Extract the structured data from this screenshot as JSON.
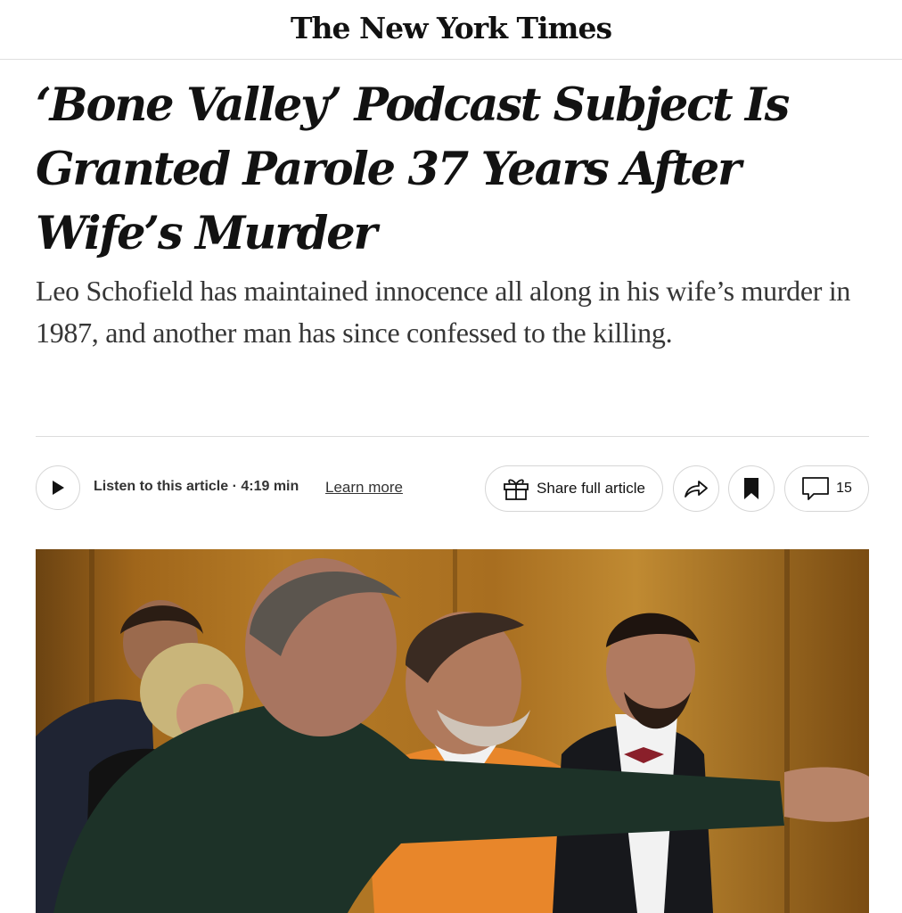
{
  "masthead": {
    "logo_text": "The New York Times"
  },
  "article": {
    "headline": "‘Bone Valley’ Podcast Subject Is Granted Parole 37 Years After Wife’s Murder",
    "summary": "Leo Schofield has maintained innocence all along in his wife’s murder in 1987, and another man has since confessed to the killing."
  },
  "toolbar": {
    "listen_label": "Listen to this article · 4:19 min",
    "learn_more": "Learn more",
    "share_label": "Share full article",
    "comment_count": "15"
  },
  "icons": {
    "play": "play-icon",
    "gift": "gift-icon",
    "share": "share-arrow-icon",
    "bookmark": "bookmark-icon",
    "comment": "comment-icon"
  }
}
